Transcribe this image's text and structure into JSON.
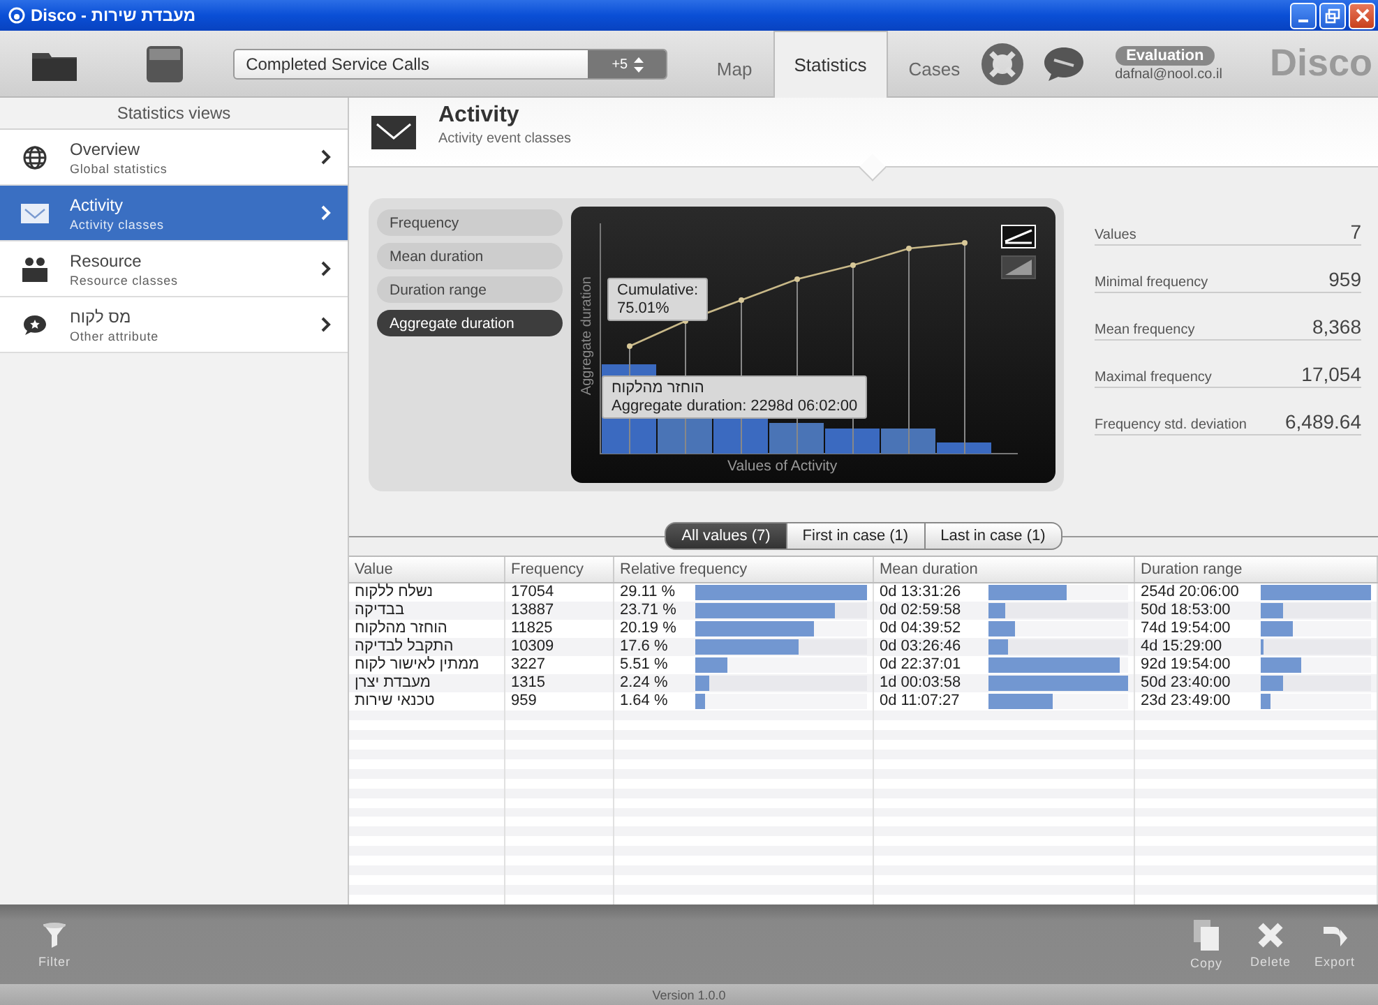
{
  "window": {
    "title": "Disco - מעבדת שירות"
  },
  "toolbar": {
    "dataset": "Completed Service Calls",
    "dataset_count": "+5",
    "tabs": [
      {
        "label": "Map",
        "selected": false
      },
      {
        "label": "Statistics",
        "selected": true
      },
      {
        "label": "Cases",
        "selected": false
      }
    ],
    "badge": "Evaluation",
    "user": "dafnal@nool.co.il",
    "logo": "Disco"
  },
  "sidebar": {
    "title": "Statistics views",
    "items": [
      {
        "kind": "globe",
        "title": "Overview",
        "subtitle": "Global statistics",
        "selected": false
      },
      {
        "kind": "envelope",
        "title": "Activity",
        "subtitle": "Activity classes",
        "selected": true
      },
      {
        "kind": "people",
        "title": "Resource",
        "subtitle": "Resource classes",
        "selected": false
      },
      {
        "kind": "bubble",
        "title": "מס לקוח",
        "subtitle": "Other attribute",
        "selected": false
      }
    ]
  },
  "header": {
    "title": "Activity",
    "subtitle": "Activity event classes"
  },
  "chart_modes": [
    {
      "label": "Frequency",
      "selected": false
    },
    {
      "label": "Mean duration",
      "selected": false
    },
    {
      "label": "Duration range",
      "selected": false
    },
    {
      "label": "Aggregate duration",
      "selected": true
    }
  ],
  "chart": {
    "ylabel": "Aggregate duration",
    "xlabel": "Values of Activity",
    "cumulative_tip": [
      "Cumulative:",
      "75.01%"
    ],
    "bar_tip": [
      "הוחזר מהלקוח",
      "Aggregate duration: 2298d 06:02:00"
    ],
    "styles": [
      {
        "kind": "cumulative",
        "selected": true
      },
      {
        "kind": "plain",
        "selected": false
      }
    ]
  },
  "stats": [
    {
      "label": "Values",
      "value": "7"
    },
    {
      "label": "Minimal frequency",
      "value": "959"
    },
    {
      "label": "Mean frequency",
      "value": "8,368"
    },
    {
      "label": "Maximal frequency",
      "value": "17,054"
    },
    {
      "label": "Frequency std. deviation",
      "value": "6,489.64"
    }
  ],
  "value_tabs": [
    {
      "label": "All values (7)",
      "selected": true
    },
    {
      "label": "First in case (1)",
      "selected": false
    },
    {
      "label": "Last in case (1)",
      "selected": false
    }
  ],
  "table": {
    "columns": [
      "Value",
      "Frequency",
      "Relative frequency",
      "Mean duration",
      "Duration range"
    ],
    "rows": [
      {
        "value": "נשלח ללקוח",
        "frequency": "17054",
        "relative": {
          "text": "29.11 %",
          "level": 1
        },
        "mean": {
          "text": "0d 13:31:26",
          "level": 0.56
        },
        "range": {
          "text": "254d 20:06:00",
          "level": 1
        }
      },
      {
        "value": "בבדיקה",
        "frequency": "13887",
        "relative": {
          "text": "23.71 %",
          "level": 0.81
        },
        "mean": {
          "text": "0d 02:59:58",
          "level": 0.12
        },
        "range": {
          "text": "50d 18:53:00",
          "level": 0.2
        }
      },
      {
        "value": "הוחזר מהלקוח",
        "frequency": "11825",
        "relative": {
          "text": "20.19 %",
          "level": 0.69
        },
        "mean": {
          "text": "0d 04:39:52",
          "level": 0.19
        },
        "range": {
          "text": "74d 19:54:00",
          "level": 0.29
        }
      },
      {
        "value": "התקבל לבדיקה",
        "frequency": "10309",
        "relative": {
          "text": "17.6 %",
          "level": 0.6
        },
        "mean": {
          "text": "0d 03:26:46",
          "level": 0.14
        },
        "range": {
          "text": "4d 15:29:00",
          "level": 0.02
        }
      },
      {
        "value": "ממתין לאישור לקוח",
        "frequency": "3227",
        "relative": {
          "text": "5.51 %",
          "level": 0.19
        },
        "mean": {
          "text": "0d 22:37:01",
          "level": 0.94
        },
        "range": {
          "text": "92d 19:54:00",
          "level": 0.37
        }
      },
      {
        "value": "מעבדת יצרן",
        "frequency": "1315",
        "relative": {
          "text": "2.24 %",
          "level": 0.08
        },
        "mean": {
          "text": "1d 00:03:58",
          "level": 1
        },
        "range": {
          "text": "50d 23:40:00",
          "level": 0.2
        }
      },
      {
        "value": "טכנאי שירות",
        "frequency": "959",
        "relative": {
          "text": "1.64 %",
          "level": 0.06
        },
        "mean": {
          "text": "0d 11:07:27",
          "level": 0.46
        },
        "range": {
          "text": "23d 23:49:00",
          "level": 0.09
        }
      }
    ]
  },
  "bottom_actions": {
    "left": [
      {
        "kind": "filter",
        "label": "Filter"
      }
    ],
    "right": [
      {
        "kind": "copy",
        "label": "Copy"
      },
      {
        "kind": "delete",
        "label": "Delete"
      },
      {
        "kind": "export",
        "label": "Export"
      }
    ]
  },
  "version": "Version 1.0.0"
}
